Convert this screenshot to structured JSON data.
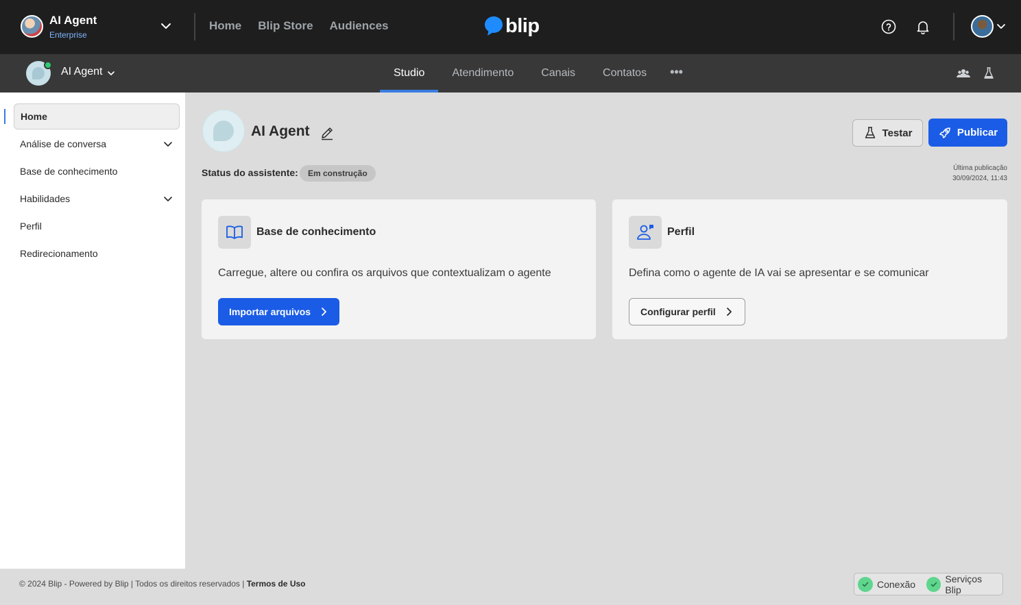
{
  "topbar": {
    "org_name": "AI Agent",
    "org_plan": "Enterprise",
    "nav": [
      "Home",
      "Blip Store",
      "Audiences"
    ],
    "brand": "blip",
    "icons": [
      "help-icon",
      "bell-icon",
      "user-avatar",
      "chevron-down-icon"
    ]
  },
  "subbar": {
    "bot_name": "AI Agent",
    "tabs": [
      "Studio",
      "Atendimento",
      "Canais",
      "Contatos"
    ],
    "active_tab": "Studio",
    "more": "•••"
  },
  "sidebar": {
    "items": [
      {
        "label": "Home",
        "active": true,
        "expandable": false
      },
      {
        "label": "Análise de conversa",
        "active": false,
        "expandable": true
      },
      {
        "label": "Base de conhecimento",
        "active": false,
        "expandable": false
      },
      {
        "label": "Habilidades",
        "active": false,
        "expandable": true
      },
      {
        "label": "Perfil",
        "active": false,
        "expandable": false
      },
      {
        "label": "Redirecionamento",
        "active": false,
        "expandable": false
      }
    ]
  },
  "main": {
    "title": "AI Agent",
    "status_label": "Status do assistente:",
    "status_value": "Em construção",
    "test_button": "Testar",
    "publish_button": "Publicar",
    "last_publish_label": "Última publicação",
    "last_publish_date": "30/09/2024, 11:43"
  },
  "cards": [
    {
      "title": "Base de conhecimento",
      "description": "Carregue, altere ou confira os arquivos que contextualizam o agente",
      "button": "Importar arquivos",
      "icon": "book-icon"
    },
    {
      "title": "Perfil",
      "description": "Defina como o agente de IA vai se apresentar e se comunicar",
      "button": "Configurar perfil",
      "icon": "profile-icon"
    }
  ],
  "footer": {
    "copyright": "© 2024 Blip - Powered by Blip | Todos os direitos reservados | ",
    "terms": "Termos de Uso",
    "health": [
      "Conexão",
      "Serviços Blip"
    ]
  },
  "colors": {
    "topbar": "#1e1e1e",
    "subbar": "#383838",
    "accent": "#1a5ce6",
    "brand_bubble": "#1e8cff",
    "healthy": "#5fd58d"
  }
}
